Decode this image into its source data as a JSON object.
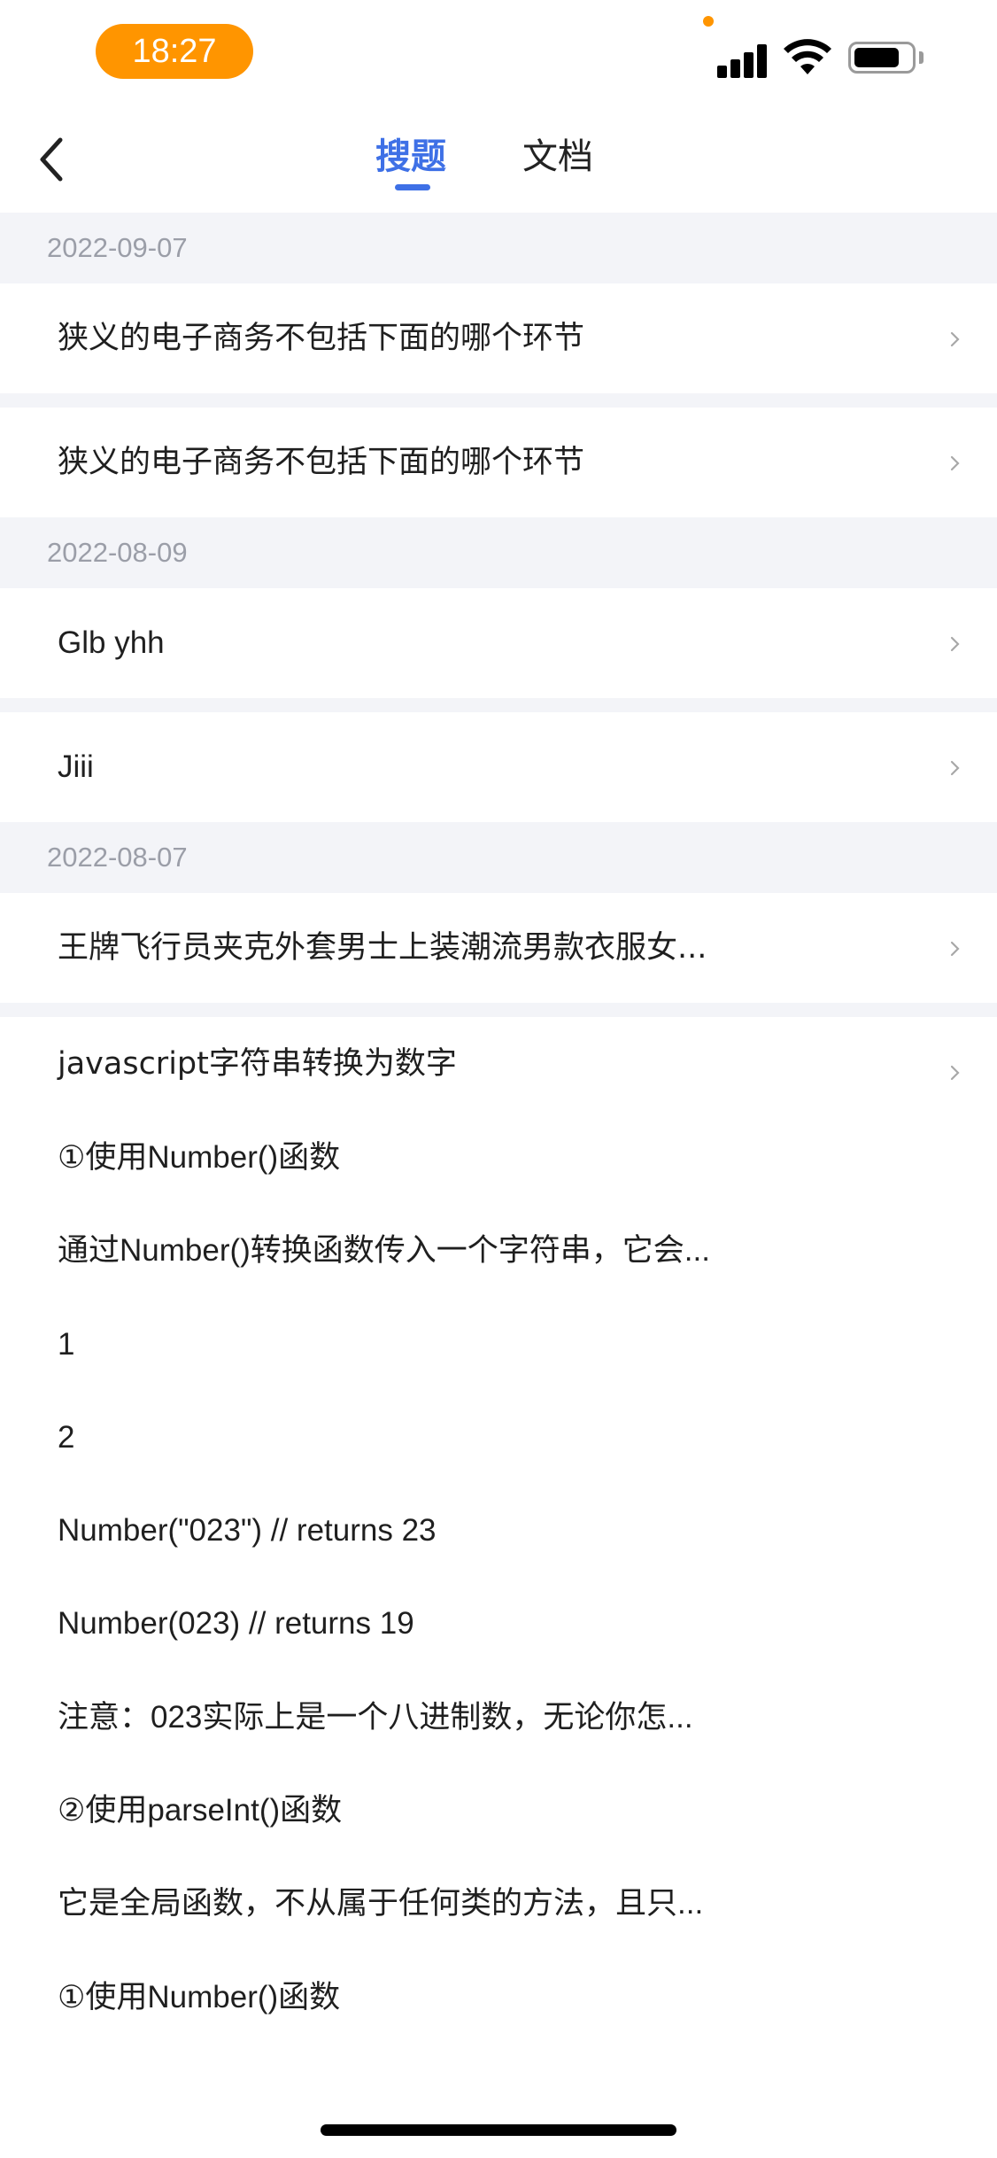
{
  "status_bar": {
    "time": "18:27",
    "icons": [
      "signal-icon",
      "wifi-icon",
      "battery-icon"
    ],
    "battery_level": 0.8
  },
  "nav": {
    "back_icon": "chevron-left-icon",
    "tabs": [
      {
        "label": "搜题",
        "active": true
      },
      {
        "label": "文档",
        "active": false
      }
    ]
  },
  "history": {
    "groups": [
      {
        "date": "2022-09-07",
        "items": [
          {
            "title": "狭义的电子商务不包括下面的哪个环节"
          },
          {
            "title": "狭义的电子商务不包括下面的哪个环节"
          }
        ]
      },
      {
        "date": "2022-08-09",
        "items": [
          {
            "title": "Glb yhh"
          },
          {
            "title": "Jiii"
          }
        ]
      },
      {
        "date": "2022-08-07",
        "items": [
          {
            "title": "王牌飞行员夹克外套男士上装潮流男款衣服女..."
          },
          {
            "title": "javascript字符串转换为数字",
            "details": [
              "①使用Number()函数",
              "通过Number()转换函数传入一个字符串，它会...",
              "1",
              "2",
              "Number(\"023\") // returns 23",
              "Number(023) // returns 19",
              "注意：023实际上是一个八进制数，无论你怎...",
              "②使用parseInt()函数",
              "它是全局函数，不从属于任何类的方法，且只...",
              "①使用Number()函数"
            ]
          }
        ]
      }
    ]
  },
  "colors": {
    "accent": "#3E70E6",
    "time_pill": "#FF9500",
    "section_bg": "#F3F4F8",
    "date_text": "#9b9ea8"
  }
}
